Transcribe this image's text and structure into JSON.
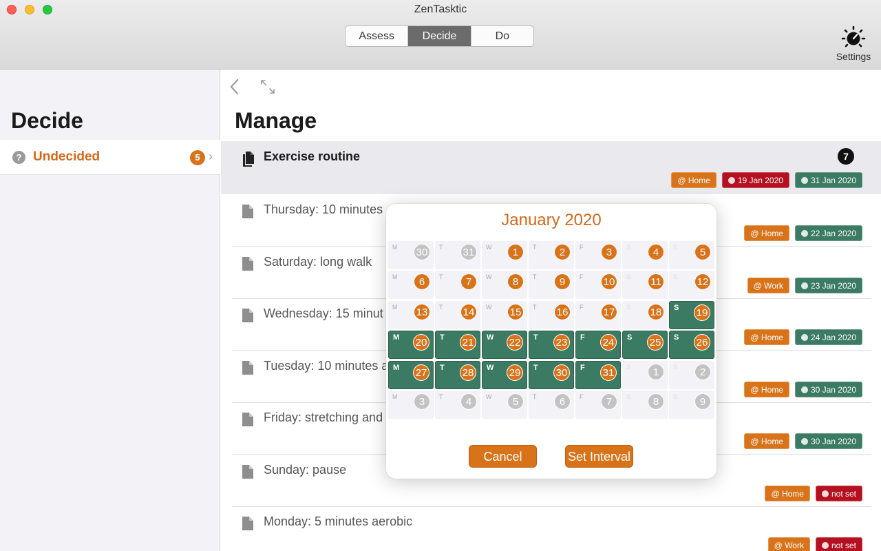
{
  "window": {
    "title": "ZenTasktic"
  },
  "toolbar": {
    "segments": [
      {
        "label": "Assess",
        "active": false
      },
      {
        "label": "Decide",
        "active": true
      },
      {
        "label": "Do",
        "active": false
      }
    ],
    "settings_label": "Settings",
    "settings_icon": "gauge-icon"
  },
  "sidebar": {
    "title": "Decide",
    "items": [
      {
        "label": "Undecided",
        "count": "5",
        "icon": "question-circle-icon"
      }
    ]
  },
  "main": {
    "title": "Manage",
    "tasks": [
      {
        "label": "Exercise routine",
        "badge": "7",
        "icon": "documents-icon",
        "tags": [
          {
            "text": "@ Home",
            "kind": "ctx"
          },
          {
            "text": "19 Jan 2020",
            "kind": "red"
          },
          {
            "text": "31 Jan 2020",
            "kind": "green"
          }
        ]
      },
      {
        "label": "Thursday: 10 minutes",
        "icon": "document-icon",
        "tags": [
          {
            "text": "@ Home",
            "kind": "ctx"
          },
          {
            "text": "22 Jan 2020",
            "kind": "green"
          }
        ]
      },
      {
        "label": "Saturday: long walk",
        "icon": "document-icon",
        "tags": [
          {
            "text": "@ Work",
            "kind": "ctx"
          },
          {
            "text": "23 Jan 2020",
            "kind": "green"
          }
        ]
      },
      {
        "label": "Wednesday: 15 minut",
        "icon": "document-icon",
        "tags": [
          {
            "text": "@ Home",
            "kind": "ctx"
          },
          {
            "text": "24 Jan 2020",
            "kind": "green"
          }
        ]
      },
      {
        "label": "Tuesday: 10 minutes a",
        "icon": "document-icon",
        "tags": [
          {
            "text": "@ Home",
            "kind": "ctx"
          },
          {
            "text": "30 Jan 2020",
            "kind": "green"
          }
        ]
      },
      {
        "label": "Friday: stretching and",
        "icon": "document-icon",
        "tags": [
          {
            "text": "@ Home",
            "kind": "ctx"
          },
          {
            "text": "30 Jan 2020",
            "kind": "green"
          }
        ]
      },
      {
        "label": "Sunday: pause",
        "icon": "document-icon",
        "tags": [
          {
            "text": "@ Home",
            "kind": "ctx"
          },
          {
            "text": "not set",
            "kind": "red"
          }
        ]
      },
      {
        "label": "Monday: 5 minutes aerobic",
        "icon": "document-icon",
        "tags": [
          {
            "text": "@ Work",
            "kind": "ctx"
          },
          {
            "text": "not set",
            "kind": "red"
          }
        ]
      }
    ]
  },
  "calendar": {
    "month_title": "January 2020",
    "weekday_letters": [
      "M",
      "T",
      "W",
      "T",
      "F",
      "S",
      "S"
    ],
    "weeks": [
      [
        {
          "d": "30",
          "other": true
        },
        {
          "d": "31",
          "other": true
        },
        {
          "d": "1"
        },
        {
          "d": "2"
        },
        {
          "d": "3"
        },
        {
          "d": "4"
        },
        {
          "d": "5"
        }
      ],
      [
        {
          "d": "6"
        },
        {
          "d": "7"
        },
        {
          "d": "8"
        },
        {
          "d": "9"
        },
        {
          "d": "10"
        },
        {
          "d": "11"
        },
        {
          "d": "12"
        }
      ],
      [
        {
          "d": "13"
        },
        {
          "d": "14"
        },
        {
          "d": "15"
        },
        {
          "d": "16"
        },
        {
          "d": "17"
        },
        {
          "d": "18"
        },
        {
          "d": "19",
          "sel": true
        }
      ],
      [
        {
          "d": "20",
          "sel": true
        },
        {
          "d": "21",
          "sel": true
        },
        {
          "d": "22",
          "sel": true
        },
        {
          "d": "23",
          "sel": true
        },
        {
          "d": "24",
          "sel": true
        },
        {
          "d": "25",
          "sel": true
        },
        {
          "d": "26",
          "sel": true
        }
      ],
      [
        {
          "d": "27",
          "sel": true
        },
        {
          "d": "28",
          "sel": true
        },
        {
          "d": "29",
          "sel": true
        },
        {
          "d": "30",
          "sel": true
        },
        {
          "d": "31",
          "sel": true
        },
        {
          "d": "1",
          "other": true
        },
        {
          "d": "2",
          "other": true
        }
      ],
      [
        {
          "d": "3",
          "other": true
        },
        {
          "d": "4",
          "other": true
        },
        {
          "d": "5",
          "other": true
        },
        {
          "d": "6",
          "other": true
        },
        {
          "d": "7",
          "other": true
        },
        {
          "d": "8",
          "other": true
        },
        {
          "d": "9",
          "other": true
        }
      ]
    ],
    "cancel_label": "Cancel",
    "set_label": "Set Interval"
  },
  "colors": {
    "accent": "#d9731a",
    "selected_range": "#3b7a63",
    "due_red": "#b5101f"
  }
}
